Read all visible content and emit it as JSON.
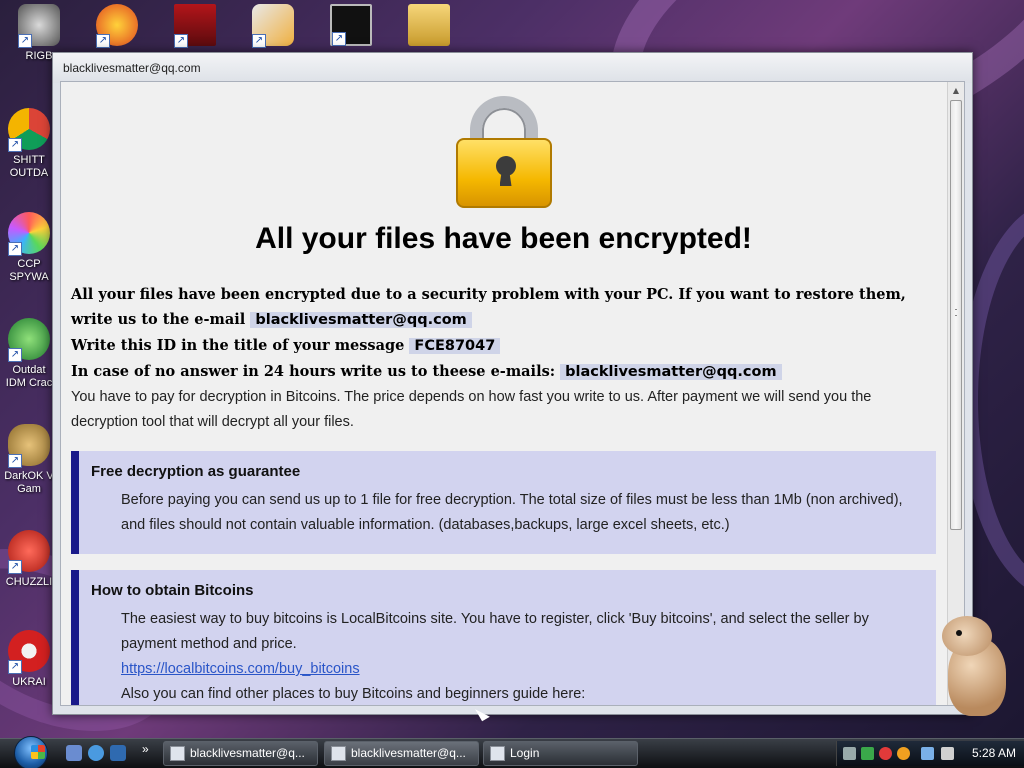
{
  "desktop": {
    "icons": [
      {
        "label": "RIGB",
        "icon": "raccoon-icon"
      },
      {
        "label": "",
        "icon": "p-app-icon"
      },
      {
        "label": "",
        "icon": "flash-icon"
      },
      {
        "label": "",
        "icon": "hxd-icon"
      },
      {
        "label": "",
        "icon": "console-icon"
      },
      {
        "label": "",
        "icon": "folder-icon"
      },
      {
        "label": "SHITT\nOUTDA",
        "icon": "chrome-icon"
      },
      {
        "label": "CCP\nSPYWA",
        "icon": "pinwheel-icon"
      },
      {
        "label": "Outdat\nIDM Crac",
        "icon": "idm-icon"
      },
      {
        "label": "DarkOK V\nGam",
        "icon": "money-bag-icon"
      },
      {
        "label": "CHUZZLI",
        "icon": "chuzzle-icon"
      },
      {
        "label": "UKRAI",
        "icon": "radiation-icon"
      }
    ]
  },
  "window": {
    "title": "blacklivesmatter@qq.com",
    "heading": "All your files have been encrypted!",
    "line1": "All your files have been encrypted due to a security problem with your PC. If you want to restore them, write us to the e-mail",
    "email1": "blacklivesmatter@qq.com",
    "line2": "Write this ID in the title of your message",
    "id": "FCE87047",
    "line3": "In case of no answer in 24 hours write us to theese e-mails:",
    "email2": "blacklivesmatter@qq.com",
    "line4": "You have to pay for decryption in Bitcoins. The price depends on how fast you write to us. After payment we will send you the decryption tool that will decrypt all your files.",
    "box1": {
      "title": "Free decryption as guarantee",
      "text": "Before paying you can send us up to 1 file for free decryption. The total size of files must be less than 1Mb (non archived), and files should not contain valuable information. (databases,backups, large excel sheets, etc.)"
    },
    "box2": {
      "title": "How to obtain Bitcoins",
      "text": "The easiest way to buy bitcoins is LocalBitcoins site. You have to register, click 'Buy bitcoins', and select the seller by payment method and price.",
      "link": "https://localbitcoins.com/buy_bitcoins",
      "text2": "Also you can find other places to buy Bitcoins and beginners guide here:"
    }
  },
  "taskbar": {
    "buttons": [
      {
        "label": "blacklivesmatter@q..."
      },
      {
        "label": "blacklivesmatter@q..."
      },
      {
        "label": "Login"
      }
    ],
    "clock": "5:28 AM",
    "overflow": "»"
  },
  "colors": {
    "box_bg": "#d2d3ef",
    "box_border": "#1a1a8a",
    "highlight_bg": "#cfd4e8",
    "link": "#2a55c8"
  }
}
